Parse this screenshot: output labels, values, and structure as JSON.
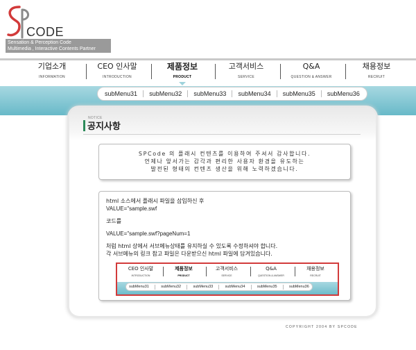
{
  "brand": {
    "logo_text": "CODE",
    "tagline_line1": "Sensation & Perception Code",
    "tagline_line2": "Multimedia , Interactive Contents Partner",
    "colors": {
      "logo_red": "#d23a3a",
      "logo_gray": "#8a8a8a",
      "band_teal": "#7cc3d0",
      "accent_green": "#2c8a5a"
    }
  },
  "nav": {
    "items": [
      {
        "ko": "기업소개",
        "en": "INFORMATION"
      },
      {
        "ko": "CEO 인사말",
        "en": "INTRODUCTION"
      },
      {
        "ko": "제품정보",
        "en": "PRODUCT"
      },
      {
        "ko": "고객서비스",
        "en": "SERVICE"
      },
      {
        "ko": "Q&A",
        "en": "QUESTION & ANSWER"
      },
      {
        "ko": "채용정보",
        "en": "RECRUIT"
      }
    ],
    "active": "제품정보"
  },
  "submenu": [
    "subMenu31",
    "subMenu32",
    "subMenu33",
    "subMenu34",
    "subMenu35",
    "subMenu36"
  ],
  "notice": {
    "small_label": "NOTICE",
    "title": "공지사항",
    "intro_lines": [
      "SPCode 의 플래시 컨텐츠를 이용하여 주셔서 감사합니다.",
      "언제나 앞서가는 감각과 편리한 사용자 환경을  유도하는",
      "발전된 형태의 컨텐츠 생산을 위해 노력하겠습니다."
    ],
    "instructions": {
      "line1": "html 소스에서 플래시 파일을 삽입하신 후",
      "line2": "VALUE=\"sample.swf",
      "line3": "코드를",
      "line4": "VALUE=\"sample.swf?pageNum=1",
      "line5": "처럼 html 상에서 서브메뉴상태를 유지하실 수  있도록 수정하셔야 합니다.",
      "line6": "각 서브메뉴의 링크 참고 파일은 다운받으신 html 파일에 담겨있습니다."
    }
  },
  "footer": {
    "copyright": "COPYRIGHT 2004 BY SPCODE"
  }
}
